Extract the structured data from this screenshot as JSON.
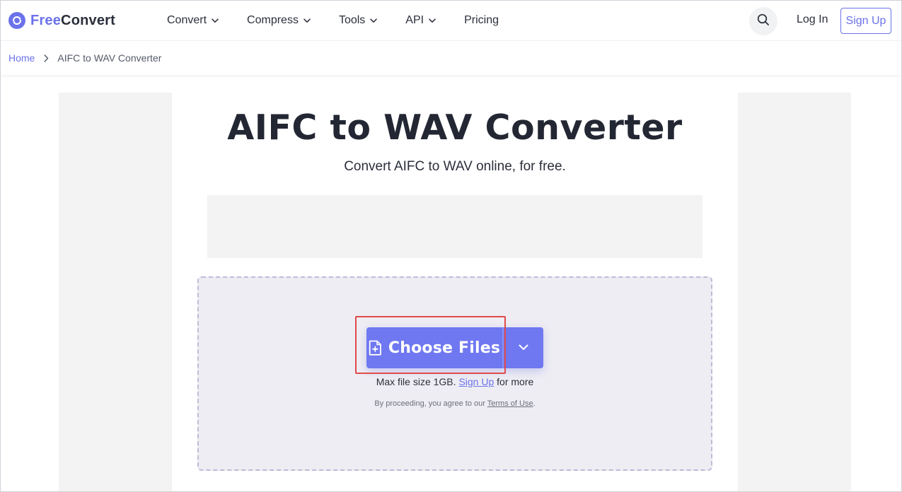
{
  "brand": {
    "free": "Free",
    "convert": "Convert",
    "accent": "#6b72ea"
  },
  "nav": {
    "items": [
      {
        "label": "Convert",
        "has_dropdown": true
      },
      {
        "label": "Compress",
        "has_dropdown": true
      },
      {
        "label": "Tools",
        "has_dropdown": true
      },
      {
        "label": "API",
        "has_dropdown": true
      },
      {
        "label": "Pricing",
        "has_dropdown": false
      }
    ],
    "login_label": "Log In",
    "signup_label": "Sign Up",
    "search_icon": "search-icon"
  },
  "breadcrumb": {
    "home": "Home",
    "current": "AIFC to WAV Converter"
  },
  "main": {
    "title": "AIFC to WAV Converter",
    "subtitle": "Convert AIFC to WAV online, for free."
  },
  "upload": {
    "choose_label": "Choose Files",
    "file_icon": "file-plus-icon",
    "dropdown_icon": "chevron-down-icon",
    "max_size_prefix": "Max file size 1GB.",
    "max_size_link": "Sign Up",
    "max_size_suffix": "for more",
    "terms_prefix": "By proceeding, you agree to our",
    "terms_link": "Terms of Use",
    "terms_suffix": ".",
    "button_color": "#6f78f0",
    "highlight_color": "#e14a4a"
  }
}
